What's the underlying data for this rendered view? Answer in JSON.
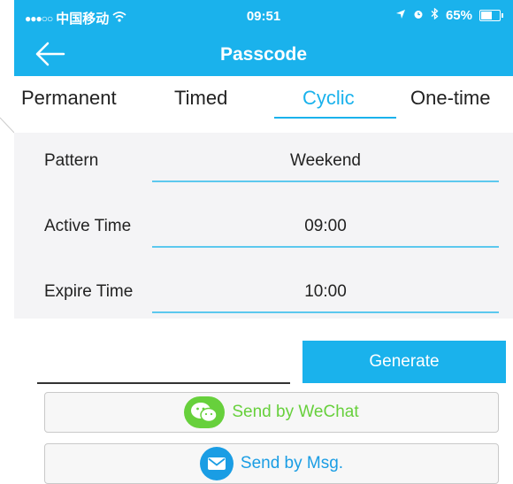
{
  "status_bar": {
    "carrier": "中国移动",
    "time": "09:51",
    "battery": "65%",
    "battery_level": 0.65
  },
  "nav": {
    "title": "Passcode",
    "back_icon": "arrow-left-icon"
  },
  "tabs": [
    {
      "label": "Permanent",
      "active": false
    },
    {
      "label": "Timed",
      "active": false
    },
    {
      "label": "Cyclic",
      "active": true
    },
    {
      "label": "One-time",
      "active": false
    }
  ],
  "form": {
    "pattern": {
      "label": "Pattern",
      "value": "Weekend"
    },
    "active_time": {
      "label": "Active Time",
      "value": "09:00"
    },
    "expire_time": {
      "label": "Expire Time",
      "value": "10:00"
    }
  },
  "generate": {
    "label": "Generate"
  },
  "send": {
    "wechat": {
      "label": "Send by WeChat",
      "icon": "wechat-icon"
    },
    "msg": {
      "label": "Send by Msg.",
      "icon": "envelope-icon"
    }
  },
  "colors": {
    "accent": "#1ab2ec",
    "wechat": "#67d03c",
    "msg": "#1a9de4",
    "form_bg": "#f4f4f6"
  }
}
